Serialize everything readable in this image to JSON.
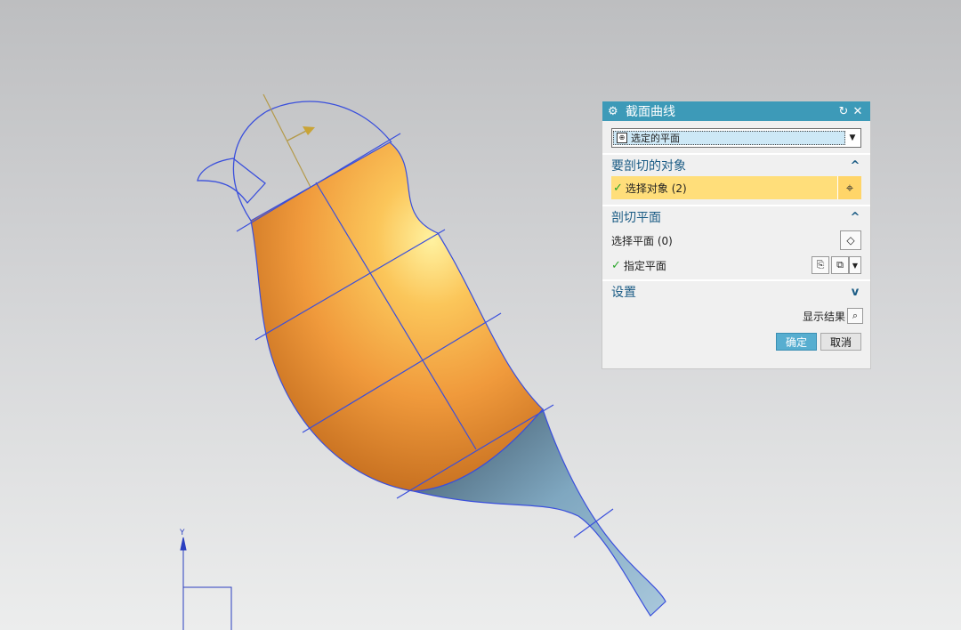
{
  "viewport": {
    "axis_label": "Y"
  },
  "dialog": {
    "title": "截面曲线",
    "title_icon": "gear-icon",
    "type_select_value": "选定的平面",
    "section_objects": {
      "header": "要剖切的对象",
      "select_label": "选择对象 (2)"
    },
    "section_plane": {
      "header": "剖切平面",
      "select_plane_label": "选择平面 (0)",
      "specify_plane_label": "指定平面"
    },
    "section_settings": {
      "header": "设置"
    },
    "show_result_label": "显示结果",
    "ok_label": "确定",
    "cancel_label": "取消"
  }
}
